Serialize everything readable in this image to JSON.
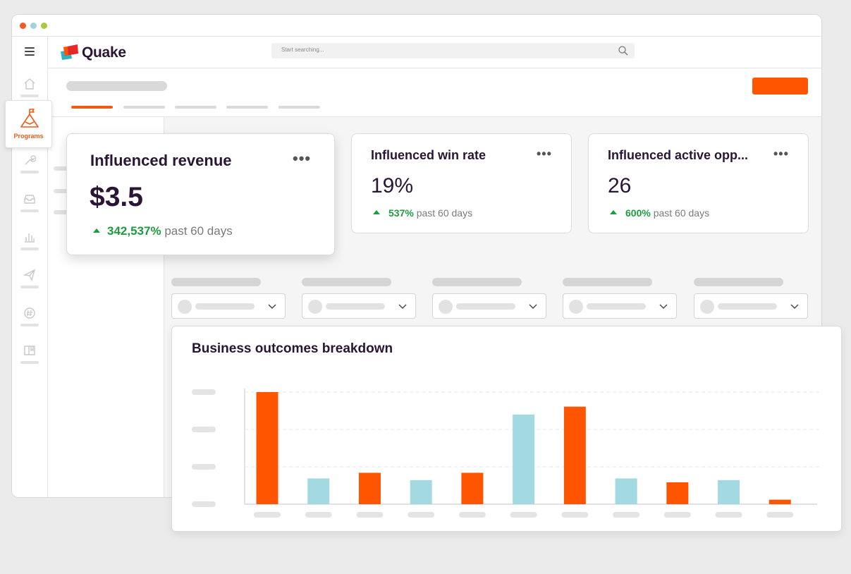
{
  "app": {
    "name": "Quake",
    "window_controls": [
      "close-dot",
      "minimize-dot",
      "zoom-dot"
    ]
  },
  "search": {
    "placeholder": "Start searching..."
  },
  "sidebar": {
    "active_item": "Programs",
    "items": [
      {
        "icon": "menu-icon"
      },
      {
        "icon": "home-icon"
      },
      {
        "icon": "flag-mountain-icon",
        "label": "Programs"
      },
      {
        "icon": "wrench-icon"
      },
      {
        "icon": "inbox-icon"
      },
      {
        "icon": "bar-chart-icon"
      },
      {
        "icon": "paper-plane-icon"
      },
      {
        "icon": "hashtag-chat-icon"
      },
      {
        "icon": "book-icon"
      }
    ]
  },
  "cards": [
    {
      "title": "Influenced revenue",
      "value": "$3.5",
      "change": "342,537%",
      "period": "past 60 days"
    },
    {
      "title": "Influenced win rate",
      "value": "19%",
      "change": "537%",
      "period": "past 60 days"
    },
    {
      "title": "Influenced active opp...",
      "value": "26",
      "change": "600%",
      "period": "past 60 days"
    }
  ],
  "colors": {
    "accent": "#ff5500",
    "secondary": "#a3d9e0",
    "trend_up": "#1e9b3c",
    "title": "#2a1535"
  },
  "chart": {
    "title": "Business outcomes breakdown"
  },
  "chart_data": {
    "type": "bar",
    "title": "Business outcomes breakdown",
    "categories": [
      "",
      "",
      "",
      "",
      "",
      "",
      "",
      "",
      "",
      "",
      ""
    ],
    "values": [
      100,
      23,
      28,
      21.5,
      28,
      80,
      87,
      23,
      19.5,
      21.5,
      4
    ],
    "bar_colors": [
      "#ff5500",
      "#a3d9e0",
      "#ff5500",
      "#a3d9e0",
      "#ff5500",
      "#a3d9e0",
      "#ff5500",
      "#a3d9e0",
      "#ff5500",
      "#a3d9e0",
      "#ff5500"
    ],
    "ylim": [
      0,
      100
    ],
    "grid": true,
    "xlabel": "",
    "ylabel": ""
  }
}
